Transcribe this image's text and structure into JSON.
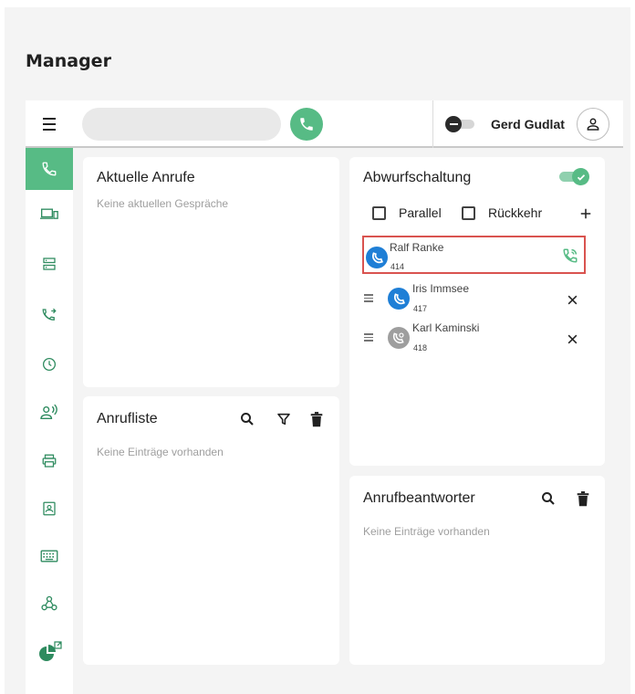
{
  "page": {
    "title": "Manager"
  },
  "header": {
    "search_value": "",
    "user_name": "Gerd Gudlat"
  },
  "sidebar": {
    "active_color": "#57bb85",
    "items": [
      {
        "icon": "phone-icon",
        "active": true
      },
      {
        "icon": "devices-icon",
        "active": false
      },
      {
        "icon": "server-icon",
        "active": false
      },
      {
        "icon": "call-forward-icon",
        "active": false
      },
      {
        "icon": "clock-icon",
        "active": false
      },
      {
        "icon": "person-speaking-icon",
        "active": false
      },
      {
        "icon": "printer-icon",
        "active": false
      },
      {
        "icon": "contact-card-icon",
        "active": false
      },
      {
        "icon": "keyboard-icon",
        "active": false
      },
      {
        "icon": "webhook-icon",
        "active": false
      },
      {
        "icon": "pie-chart-external-icon",
        "active": false
      }
    ]
  },
  "current_calls": {
    "title": "Aktuelle Anrufe",
    "empty_text": "Keine aktuellen Gespräche"
  },
  "call_list": {
    "title": "Anrufliste",
    "empty_text": "Keine Einträge vorhanden"
  },
  "call_forwarding": {
    "title": "Abwurfschaltung",
    "enabled": true,
    "parallel_label": "Parallel",
    "return_label": "Rückkehr",
    "destinations": [
      {
        "name": "Ralf Ranke",
        "ext": "414",
        "status": "available",
        "highlighted": true
      },
      {
        "name": "Iris Immsee",
        "ext": "417",
        "status": "available",
        "highlighted": false
      },
      {
        "name": "Karl Kaminski",
        "ext": "418",
        "status": "unavailable",
        "highlighted": false
      }
    ]
  },
  "voicemail": {
    "title": "Anrufbeantworter",
    "empty_text": "Keine Einträge vorhanden"
  },
  "colors": {
    "accent_green": "#57bb85",
    "available_blue": "#1f7fd6",
    "unavailable_grey": "#9e9e9e",
    "highlight_red": "#d9534f"
  }
}
